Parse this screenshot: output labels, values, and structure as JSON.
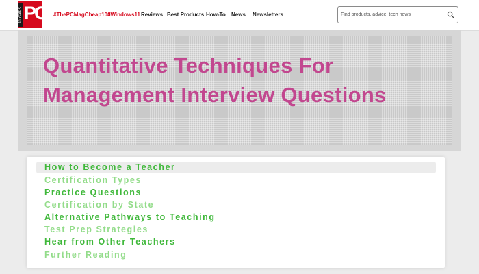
{
  "header": {
    "logo_text": "PC",
    "logo_badge": "40 YEARS",
    "nav_items": [
      {
        "label": "#ThePCMagCheap100",
        "highlight": true
      },
      {
        "label": "#Windows11",
        "highlight": true
      },
      {
        "label": "Reviews",
        "highlight": false
      },
      {
        "label": "Best Products",
        "highlight": false
      },
      {
        "label": "How-To",
        "highlight": false
      },
      {
        "label": "News",
        "highlight": false
      },
      {
        "label": "Newsletters",
        "highlight": false
      }
    ],
    "search": {
      "placeholder": "Find products, advice, tech news",
      "icon": "search-icon"
    },
    "colors": {
      "brand": "#d60a1e"
    }
  },
  "hero": {
    "title": "Quantitative Techniques For Management Interview Questions",
    "title_color": "#c2478f"
  },
  "toc": {
    "link_color": "#3fb83a",
    "items": [
      {
        "label": "How to Become a Teacher"
      },
      {
        "label": "Certification Types"
      },
      {
        "label": "Practice Questions"
      },
      {
        "label": "Certification by State"
      },
      {
        "label": "Alternative Pathways to Teaching"
      },
      {
        "label": "Test Prep Strategies"
      },
      {
        "label": "Hear from Other Teachers"
      },
      {
        "label": "Further Reading"
      }
    ]
  }
}
